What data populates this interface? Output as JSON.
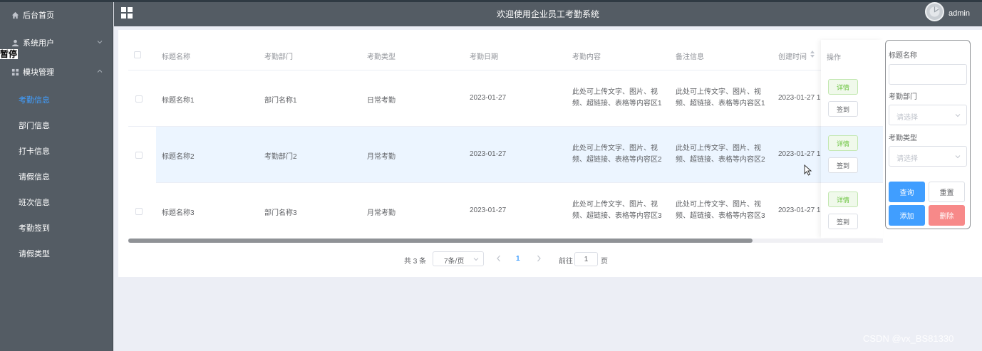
{
  "sidebar": {
    "overlay_text": "暂停",
    "items": [
      {
        "label": "后台首页",
        "icon": "home-icon"
      },
      {
        "label": "系统用户",
        "icon": "user-icon"
      },
      {
        "label": "模块管理",
        "icon": "grid-icon"
      }
    ],
    "sub_items": [
      {
        "label": "考勤信息",
        "active": true
      },
      {
        "label": "部门信息"
      },
      {
        "label": "打卡信息"
      },
      {
        "label": "请假信息"
      },
      {
        "label": "班次信息"
      },
      {
        "label": "考勤签到"
      },
      {
        "label": "请假类型"
      }
    ]
  },
  "header": {
    "title": "欢迎使用企业员工考勤系统",
    "user": "admin"
  },
  "table": {
    "columns": [
      "标题名称",
      "考勤部门",
      "考勤类型",
      "考勤日期",
      "考勤内容",
      "备注信息",
      "创建时间",
      "操作"
    ],
    "rows": [
      {
        "title": "标题名称1",
        "dept": "部门名称1",
        "type": "日常考勤",
        "date": "2023-01-27",
        "content_l1": "此处可上传文字、图片、视",
        "content_l2": "频、超链接、表格等内容区1",
        "remark_l1": "此处可上传文字、图片、视",
        "remark_l2": "频、超链接、表格等内容区1",
        "created": "2023-01-27 1"
      },
      {
        "title": "标题名称2",
        "dept": "考勤部门2",
        "type": "月常考勤",
        "date": "2023-01-27",
        "content_l1": "此处可上传文字、图片、视",
        "content_l2": "频、超链接、表格等内容区2",
        "remark_l1": "此处可上传文字、图片、视",
        "remark_l2": "频、超链接、表格等内容区2",
        "created": "2023-01-27 1"
      },
      {
        "title": "标题名称3",
        "dept": "部门名称3",
        "type": "月常考勤",
        "date": "2023-01-27",
        "content_l1": "此处可上传文字、图片、视",
        "content_l2": "频、超链接、表格等内容区3",
        "remark_l1": "此处可上传文字、图片、视",
        "remark_l2": "频、超链接、表格等内容区3",
        "created": "2023-01-27 1"
      }
    ],
    "actions": {
      "detail": "详情",
      "sign": "签到"
    }
  },
  "pager": {
    "total": "共 3 条",
    "page_size": "7条/页",
    "current": "1",
    "goto_label": "前往",
    "goto_value": "1",
    "page_label": "页"
  },
  "search": {
    "title_label": "标题名称",
    "title_value": "",
    "dept_label": "考勤部门",
    "dept_placeholder": "请选择",
    "type_label": "考勤类型",
    "type_placeholder": "请选择",
    "query": "查询",
    "reset": "重置",
    "add": "添加",
    "delete": "删除"
  },
  "watermark": "CSDN @vx_BS81330",
  "colors": {
    "sidebar": "#545c64",
    "primary": "#409eff",
    "success": "#67c23a",
    "danger": "#f78989"
  }
}
